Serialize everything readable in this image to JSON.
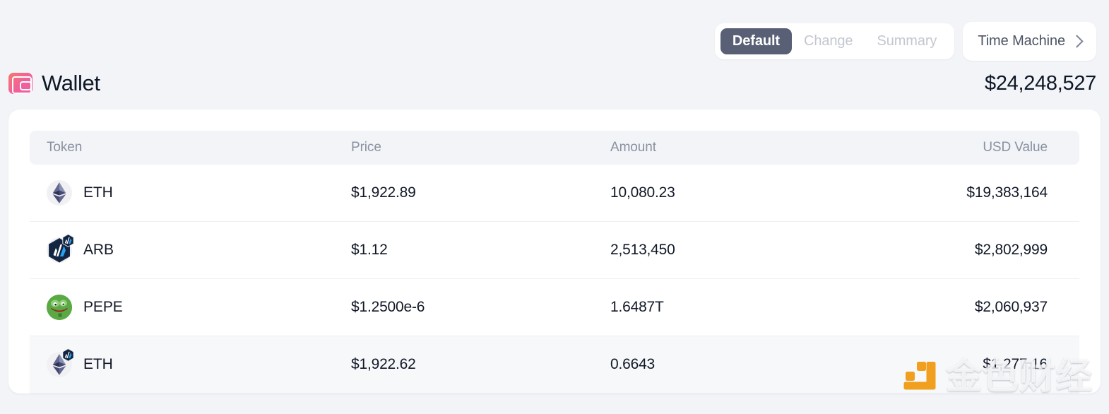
{
  "toolbar": {
    "segments": [
      {
        "label": "Default",
        "active": true
      },
      {
        "label": "Change",
        "active": false
      },
      {
        "label": "Summary",
        "active": false
      }
    ],
    "time_machine_label": "Time Machine",
    "chevron_icon": "chevron-right-icon",
    "active_pill_color": "#595f75"
  },
  "header": {
    "icon": "wallet-icon",
    "title": "Wallet",
    "total_value": "$24,248,527"
  },
  "table": {
    "columns": [
      "Token",
      "Price",
      "Amount",
      "USD Value"
    ],
    "rows": [
      {
        "token": "ETH",
        "logo": "ethereum-logo",
        "badge": null,
        "price": "$1,922.89",
        "amount": "10,080.23",
        "usd_value": "$19,383,164",
        "highlight": false
      },
      {
        "token": "ARB",
        "logo": "arbitrum-logo",
        "badge": "arbitrum-badge",
        "price": "$1.12",
        "amount": "2,513,450",
        "usd_value": "$2,802,999",
        "highlight": false
      },
      {
        "token": "PEPE",
        "logo": "pepe-logo",
        "badge": null,
        "price": "$1.2500e-6",
        "amount": "1.6487T",
        "usd_value": "$2,060,937",
        "highlight": false
      },
      {
        "token": "ETH",
        "logo": "ethereum-logo",
        "badge": "arbitrum-badge",
        "price": "$1,922.62",
        "amount": "0.6643",
        "usd_value": "$1,277.16",
        "highlight": true
      }
    ]
  },
  "watermark": {
    "text": "金色财经",
    "logo": "jinse-logo",
    "color": "#f0a01e"
  }
}
